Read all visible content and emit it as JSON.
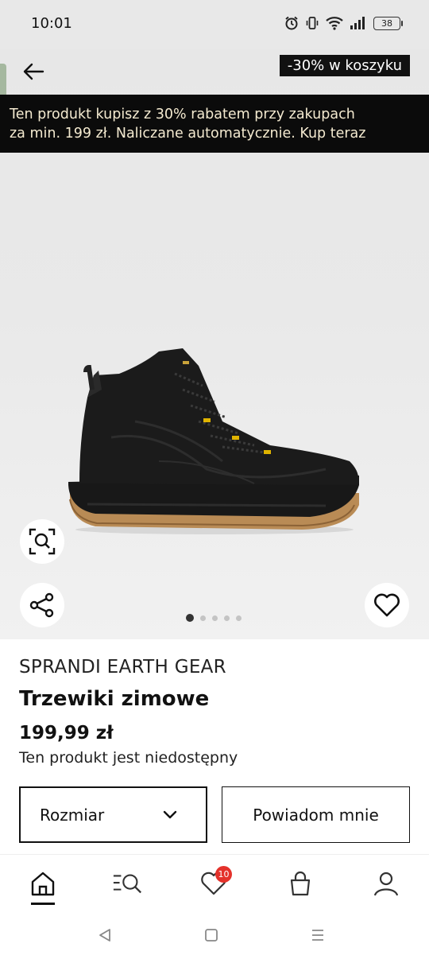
{
  "status_bar": {
    "time": "10:01",
    "battery": "38"
  },
  "header": {
    "promo_tag": "-30% w koszyku",
    "promo_line1": "Ten produkt kupisz z 30% rabatem przy zakupach",
    "promo_line2": "za min. 199 zł. Naliczane automatycznie. Kup teraz"
  },
  "gallery": {
    "image_count": 5,
    "active_index": 0
  },
  "product": {
    "brand": "SPRANDI EARTH GEAR",
    "name": "Trzewiki zimowe",
    "price": "199,99 zł",
    "availability": "Ten produkt jest niedostępny"
  },
  "actions": {
    "size_label": "Rozmiar",
    "notify_label": "Powiadom mnie"
  },
  "bottom_nav": {
    "items": [
      "home-icon",
      "catalog-search-icon",
      "heart-icon",
      "bag-icon",
      "account-icon"
    ],
    "active": "home",
    "favorites_badge": "10"
  },
  "colors": {
    "promo_bg": "#0b0b0b",
    "promo_text": "#f4ead0",
    "badge": "#e4322b"
  }
}
